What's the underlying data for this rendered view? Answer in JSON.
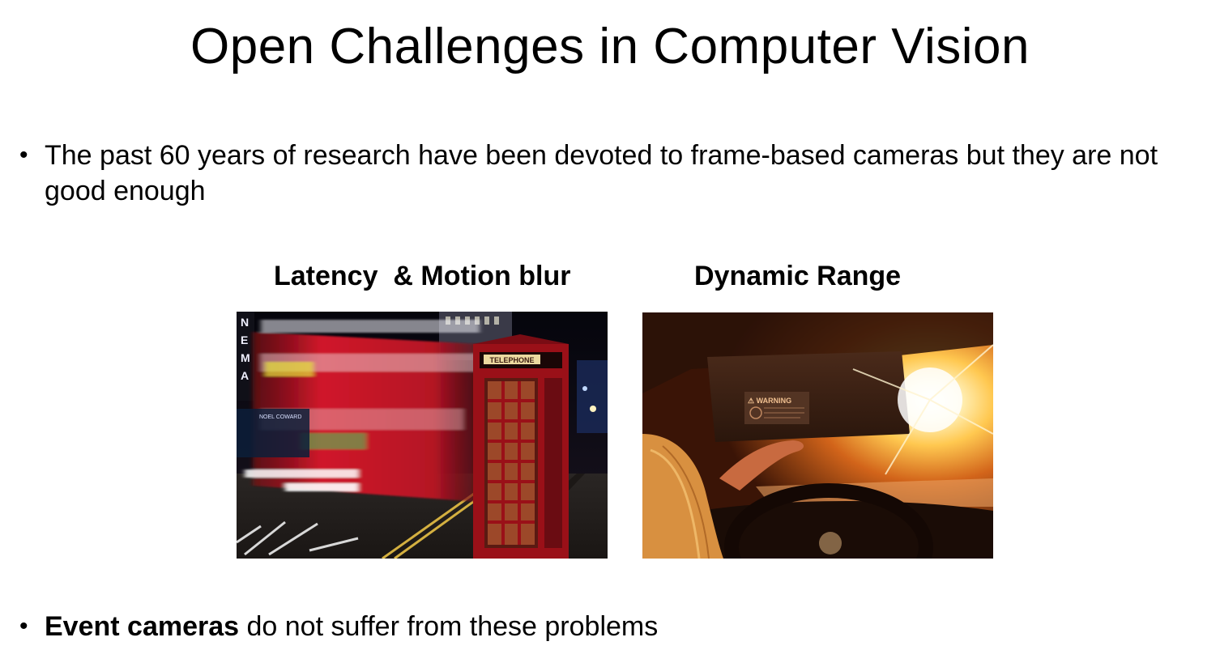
{
  "slide": {
    "title": "Open Challenges in Computer Vision",
    "bullet1": {
      "marker": "•",
      "text": "The past 60 years of research have been devoted to frame-based cameras but they are not good enough"
    },
    "captions": {
      "left": "Latency  & Motion blur",
      "right": "Dynamic Range"
    },
    "photo_left": {
      "booth_sign": "TELEPHONE",
      "sign_letters": [
        "N",
        "E",
        "M",
        "A"
      ],
      "shop_sign": "NOEL COWARD"
    },
    "photo_right": {
      "visor_label": "⚠ WARNING"
    },
    "bullet2": {
      "marker": "•",
      "bold": "Event cameras",
      "rest": " do not suffer from these problems"
    }
  }
}
